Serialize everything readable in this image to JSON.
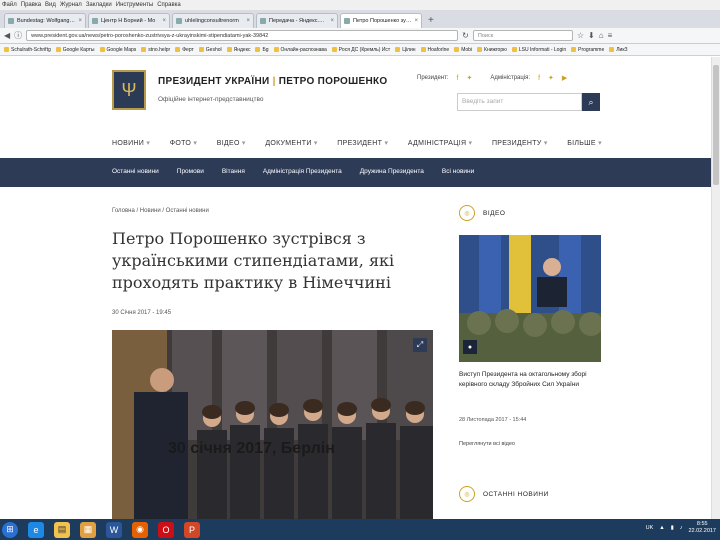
{
  "browser": {
    "menu": [
      "Файл",
      "Правка",
      "Вид",
      "Журнал",
      "Закладки",
      "Инструменты",
      "Справка"
    ],
    "tabs": [
      {
        "label": "Bundestag: Wolfgang Schäub",
        "active": false
      },
      {
        "label": "Центр Н Борний - Мо",
        "active": false
      },
      {
        "label": "uhlelingconsultrenorm",
        "active": false
      },
      {
        "label": "Передача - Яндекс.Видео",
        "active": false
      },
      {
        "label": "Петро Порошенко зустр",
        "active": true
      }
    ],
    "url": "www.president.gov.ua/news/petro-poroshenko-zustrivsya-z-ukrayinskimi-stipendiatami-yak-39842",
    "search_placeholder": "Поиск",
    "bookmarks": [
      "Schulrath-Schriftg",
      "Google Карты",
      "Google Maps",
      "stno.helpr",
      "Ферт",
      "Geshol",
      "Яндекс",
      "Бg",
      "Онлайн-распознава",
      "Рося ДС (Кремль) Ист",
      "Цілин",
      "Hoaforlne",
      "Mobi",
      "Книжгорю",
      "LSU Informati - Login",
      "Programme",
      "ЛикЗ"
    ]
  },
  "site": {
    "title_left": "ПРЕЗИДЕНТ УКРАЇНИ",
    "title_right": "ПЕТРО ПОРОШЕНКО",
    "subtitle": "Офіційне інтернет-представництво",
    "president_label": "Президент:",
    "admin_label": "Адміністрація:",
    "search_placeholder": "Введіть запит"
  },
  "main_nav": [
    "НОВИНИ",
    "ФОТО",
    "ВІДЕО",
    "ДОКУМЕНТИ",
    "ПРЕЗИДЕНТ",
    "АДМІНІСТРАЦІЯ",
    "ПРЕЗИДЕНТУ",
    "БІЛЬШЕ"
  ],
  "sub_nav": [
    "Останні новини",
    "Промови",
    "Вітання",
    "Адміністрація Президента",
    "Дружина Президента",
    "Всі новини"
  ],
  "article": {
    "breadcrumb": "Головна  /  Новини  /  Останні новини",
    "headline": "Петро Порошенко зустрівся з українськими стипендіатами, які проходять практику в Німеччині",
    "date": "30 Січня 2017 - 19:45",
    "caption": "30 січня 2017, Берлін"
  },
  "sidebar": {
    "video_label": "ВІДЕО",
    "video_title": "Виступ Президента на октагольному зборі керівного складу Збройних Сил України",
    "video_date": "28 Листопада 2017 - 15:44",
    "video_more": "Переглянути всі відео",
    "news_label": "ОСТАННІ НОВИНИ"
  },
  "taskbar": {
    "lang": "UK",
    "time": "8:55",
    "date": "22.02.2017"
  },
  "colors": {
    "navy": "#2d3b57",
    "gold": "#c9a227",
    "taskbar": "#1d3b5c"
  }
}
